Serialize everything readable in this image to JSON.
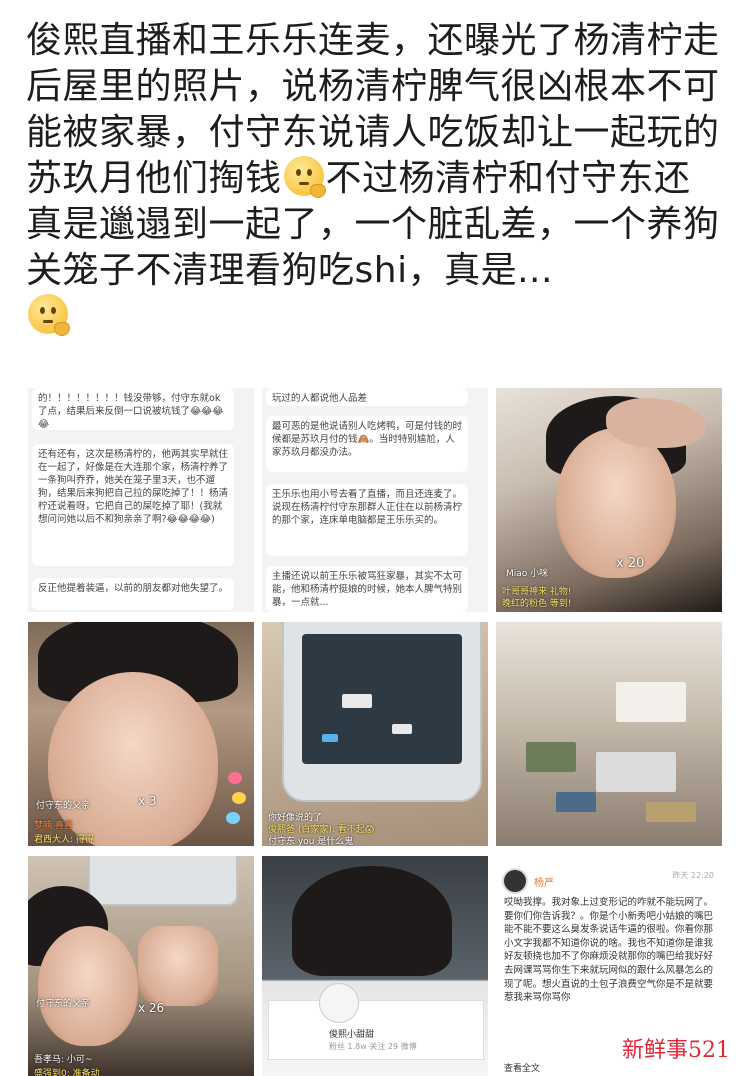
{
  "post": {
    "text_part1": "俊熙直播和王乐乐连麦，还曝光了杨清柠走后屋里的照片，说杨清柠脾气很凶根本不可能被家暴，付守东说请人吃饭却让一起玩的苏玖月他们掏钱",
    "text_part2": "不过杨清柠和付守东还真是邋遢到一起了，一个脏乱差，一个养狗关笼子不清理看狗吃shi，真是...",
    "emoji_icon": "thinking-face-icon"
  },
  "images": {
    "chat1": {
      "b1": "的！！！！！！！！钱没带够，付守东就ok了点，结果后来反倒一口说被坑钱了😂😂😂😂",
      "b2": "还有还有，这次是杨清柠的，他两其实早就住在一起了，好像是在大连那个家，杨清柠养了一条狗叫乔乔，她关在笼子里3天，也不遛狗，结果后来狗把自己拉的屎吃掉了！！杨清柠还说看呀，它把自己的屎吃掉了耶！(我就想问问她以后不和狗亲亲了啊?😂😂😂😂)",
      "b3": "反正他提着装逼，以前的朋友都对他失望了。"
    },
    "chat2": {
      "b1": "玩过的人都说他人品差",
      "b2": "最可恶的是他说请别人吃烤鸭，可是付钱的时候都是苏玖月付的钱🙈。当时特别尴尬，人家苏玖月都没办法。",
      "b3": "王乐乐也用小号去看了直播，而且还连麦了。说现在杨清柠付守东那群人正住在以前杨清柠的那个家，连床单电脑都是王乐乐买的。",
      "b4": "主播还说以前王乐乐被骂狂家暴，其实不太可能，他和杨清柠挺娘的时候，她本人脾气特别暴，一点就..."
    },
    "live1": {
      "tag": "Miao 小咪",
      "count": "x 20",
      "line1": "叶哥哥神来 礼物!",
      "line2": "晚红的粉色 等到!"
    },
    "live2": {
      "name": "付守东的父亲",
      "count": "x 3",
      "line1": "梦喃 喜喜",
      "line2": "君西大人: 得得"
    },
    "live3": {
      "line1": "你好像说的了",
      "line2": "俊熙爸 (白家家): 看不起😱",
      "line3": "付守东 you 是什么鬼"
    },
    "live5": {
      "name": "付守东的父亲",
      "count": "x 26",
      "line1": "吾孝马: 小可~",
      "line2": "盛强到0: 准备动"
    },
    "profile": {
      "name": "俊熙小甜甜",
      "meta": "粉丝 1.8w 关注 29 微博"
    },
    "comment": {
      "user": "杨严",
      "time": "昨天 22:20",
      "body": "哎呦我撑。我对象上过变形记的咋就不能玩网了。要你们你告诉我？。你是个小新秀吧小姑娘的嘴巴能不能不要这么臭发条说话牛逼的很啦。你看你那小文字我都不知道你说的啥。我也不知道你是谁我好友顿挠也加不了你麻烦没就那你的嘴巴给我好好去网课骂骂你生下来就玩网似的跟什么风暴怎么的现了呢。想火直说的土包子浪费空气你是不是就要惹我来骂你骂你",
      "more": "查看全文"
    }
  },
  "watermark": "新鲜事521"
}
